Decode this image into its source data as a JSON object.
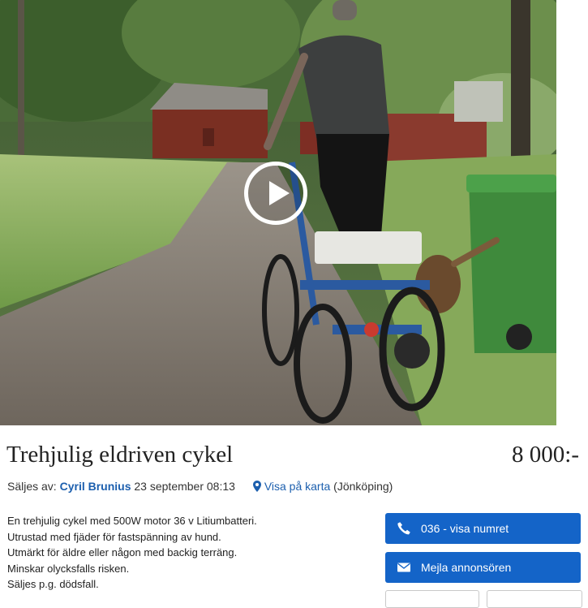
{
  "listing": {
    "title": "Trehjulig eldriven cykel",
    "price": "8 000:-"
  },
  "meta": {
    "sold_by_label": "Säljes av:",
    "seller_name": "Cyril Brunius",
    "date": "23 september 08:13",
    "map_link": "Visa på karta",
    "location": "(Jönköping)"
  },
  "description": [
    "En trehjulig cykel med 500W motor 36 v Litiumbatteri.",
    "Utrustad med fjäder för fastspänning av hund.",
    "Utmärkt för äldre eller någon med backig terräng.",
    "Minskar olycksfalls risken.",
    "Säljes p.g. dödsfall."
  ],
  "actions": {
    "phone_label": "036 - visa numret",
    "email_label": "Mejla annonsören"
  },
  "icons": {
    "play": "play-icon",
    "pin": "map-pin-icon",
    "phone": "phone-icon",
    "mail": "envelope-icon"
  },
  "colors": {
    "accent": "#1464c8",
    "link": "#1c5fae"
  }
}
